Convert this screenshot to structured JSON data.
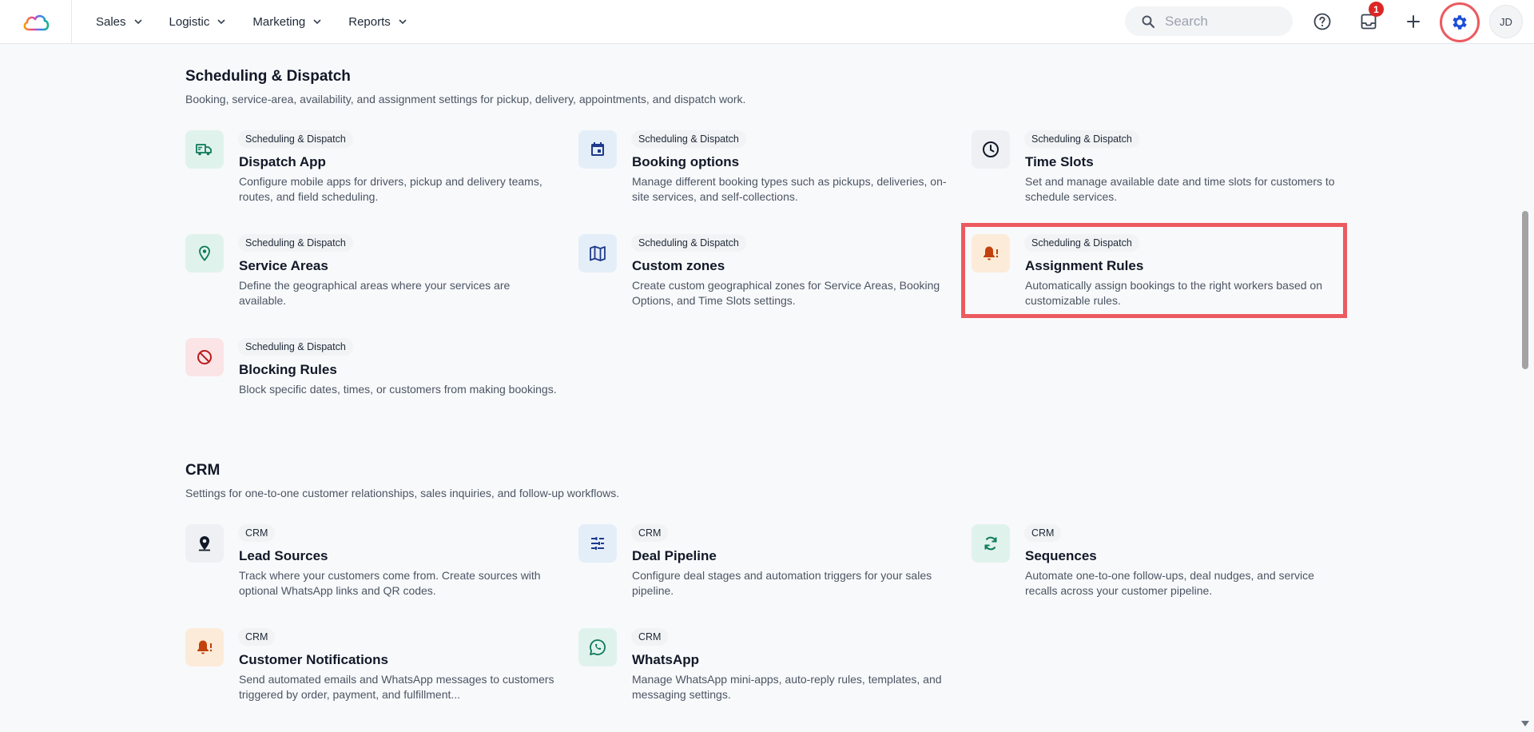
{
  "nav": {
    "items": [
      {
        "label": "Sales"
      },
      {
        "label": "Logistic"
      },
      {
        "label": "Marketing"
      },
      {
        "label": "Reports"
      }
    ],
    "search_placeholder": "Search",
    "notification_count": "1",
    "avatar_initials": "JD"
  },
  "sections": [
    {
      "title": "Scheduling & Dispatch",
      "description": "Booking, service-area, availability, and assignment settings for pickup, delivery, appointments, and dispatch work.",
      "cards": [
        {
          "tag": "Scheduling & Dispatch",
          "title": "Dispatch App",
          "description": "Configure mobile apps for drivers, pickup and delivery teams, routes, and field scheduling.",
          "icon": "truck-icon"
        },
        {
          "tag": "Scheduling & Dispatch",
          "title": "Booking options",
          "description": "Manage different booking types such as pickups, deliveries, on-site services, and self-collections.",
          "icon": "calendar-icon"
        },
        {
          "tag": "Scheduling & Dispatch",
          "title": "Time Slots",
          "description": "Set and manage available date and time slots for customers to schedule services.",
          "icon": "clock-icon"
        },
        {
          "tag": "Scheduling & Dispatch",
          "title": "Service Areas",
          "description": "Define the geographical areas where your services are available.",
          "icon": "location-pin-icon"
        },
        {
          "tag": "Scheduling & Dispatch",
          "title": "Custom zones",
          "description": "Create custom geographical zones for Service Areas, Booking Options, and Time Slots settings.",
          "icon": "map-icon"
        },
        {
          "tag": "Scheduling & Dispatch",
          "title": "Assignment Rules",
          "description": "Automatically assign bookings to the right workers based on customizable rules.",
          "icon": "bell-alert-icon"
        },
        {
          "tag": "Scheduling & Dispatch",
          "title": "Blocking Rules",
          "description": "Block specific dates, times, or customers from making bookings.",
          "icon": "block-icon"
        }
      ]
    },
    {
      "title": "CRM",
      "description": "Settings for one-to-one customer relationships, sales inquiries, and follow-up workflows.",
      "cards": [
        {
          "tag": "CRM",
          "title": "Lead Sources",
          "description": "Track where your customers come from. Create sources with optional WhatsApp links and QR codes.",
          "icon": "pin-source-icon"
        },
        {
          "tag": "CRM",
          "title": "Deal Pipeline",
          "description": "Configure deal stages and automation triggers for your sales pipeline.",
          "icon": "pipeline-icon"
        },
        {
          "tag": "CRM",
          "title": "Sequences",
          "description": "Automate one-to-one follow-ups, deal nudges, and service recalls across your customer pipeline.",
          "icon": "refresh-icon"
        },
        {
          "tag": "CRM",
          "title": "Customer Notifications",
          "description": "Send automated emails and WhatsApp messages to customers triggered by order, payment, and fulfillment...",
          "icon": "bell-alert-icon"
        },
        {
          "tag": "CRM",
          "title": "WhatsApp",
          "description": "Manage WhatsApp mini-apps, auto-reply rules, templates, and messaging settings.",
          "icon": "whatsapp-icon"
        }
      ]
    }
  ]
}
